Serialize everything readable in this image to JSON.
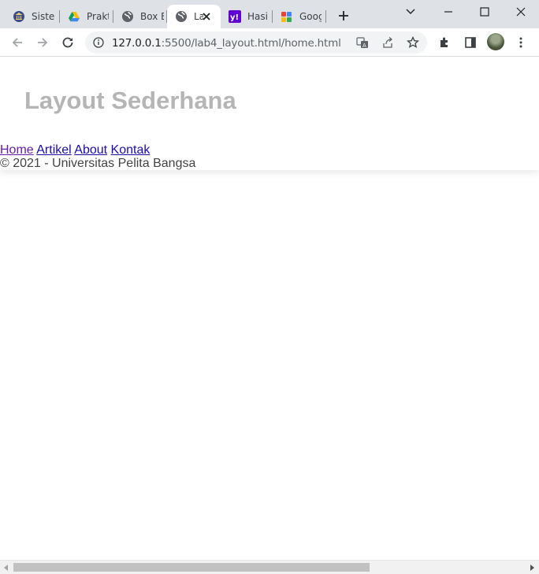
{
  "browser": {
    "tabs": [
      {
        "label": "Sistem",
        "icon": "university-icon",
        "active": false
      },
      {
        "label": "Prakt",
        "icon": "google-drive-icon",
        "active": false
      },
      {
        "label": "Box B",
        "icon": "globe-icon",
        "active": false
      },
      {
        "label": "La",
        "icon": "globe-icon",
        "active": true
      },
      {
        "label": "Hasil",
        "icon": "yahoo-icon",
        "active": false
      },
      {
        "label": "Goog",
        "icon": "google-apps-icon",
        "active": false
      }
    ],
    "url": {
      "host": "127.0.0.1",
      "path": ":5500/lab4_layout.html/home.html"
    }
  },
  "page": {
    "title": "Layout Sederhana",
    "nav": [
      {
        "label": "Home",
        "visited": true
      },
      {
        "label": "Artikel",
        "visited": false
      },
      {
        "label": "About",
        "visited": false
      },
      {
        "label": "Kontak",
        "visited": false
      }
    ],
    "footer": "© 2021 - Universitas Pelita Bangsa"
  },
  "colors": {
    "title": "#b5b5b5",
    "link": "#1a0dab",
    "link_visited": "#681da8",
    "footer_text": "#444444"
  }
}
